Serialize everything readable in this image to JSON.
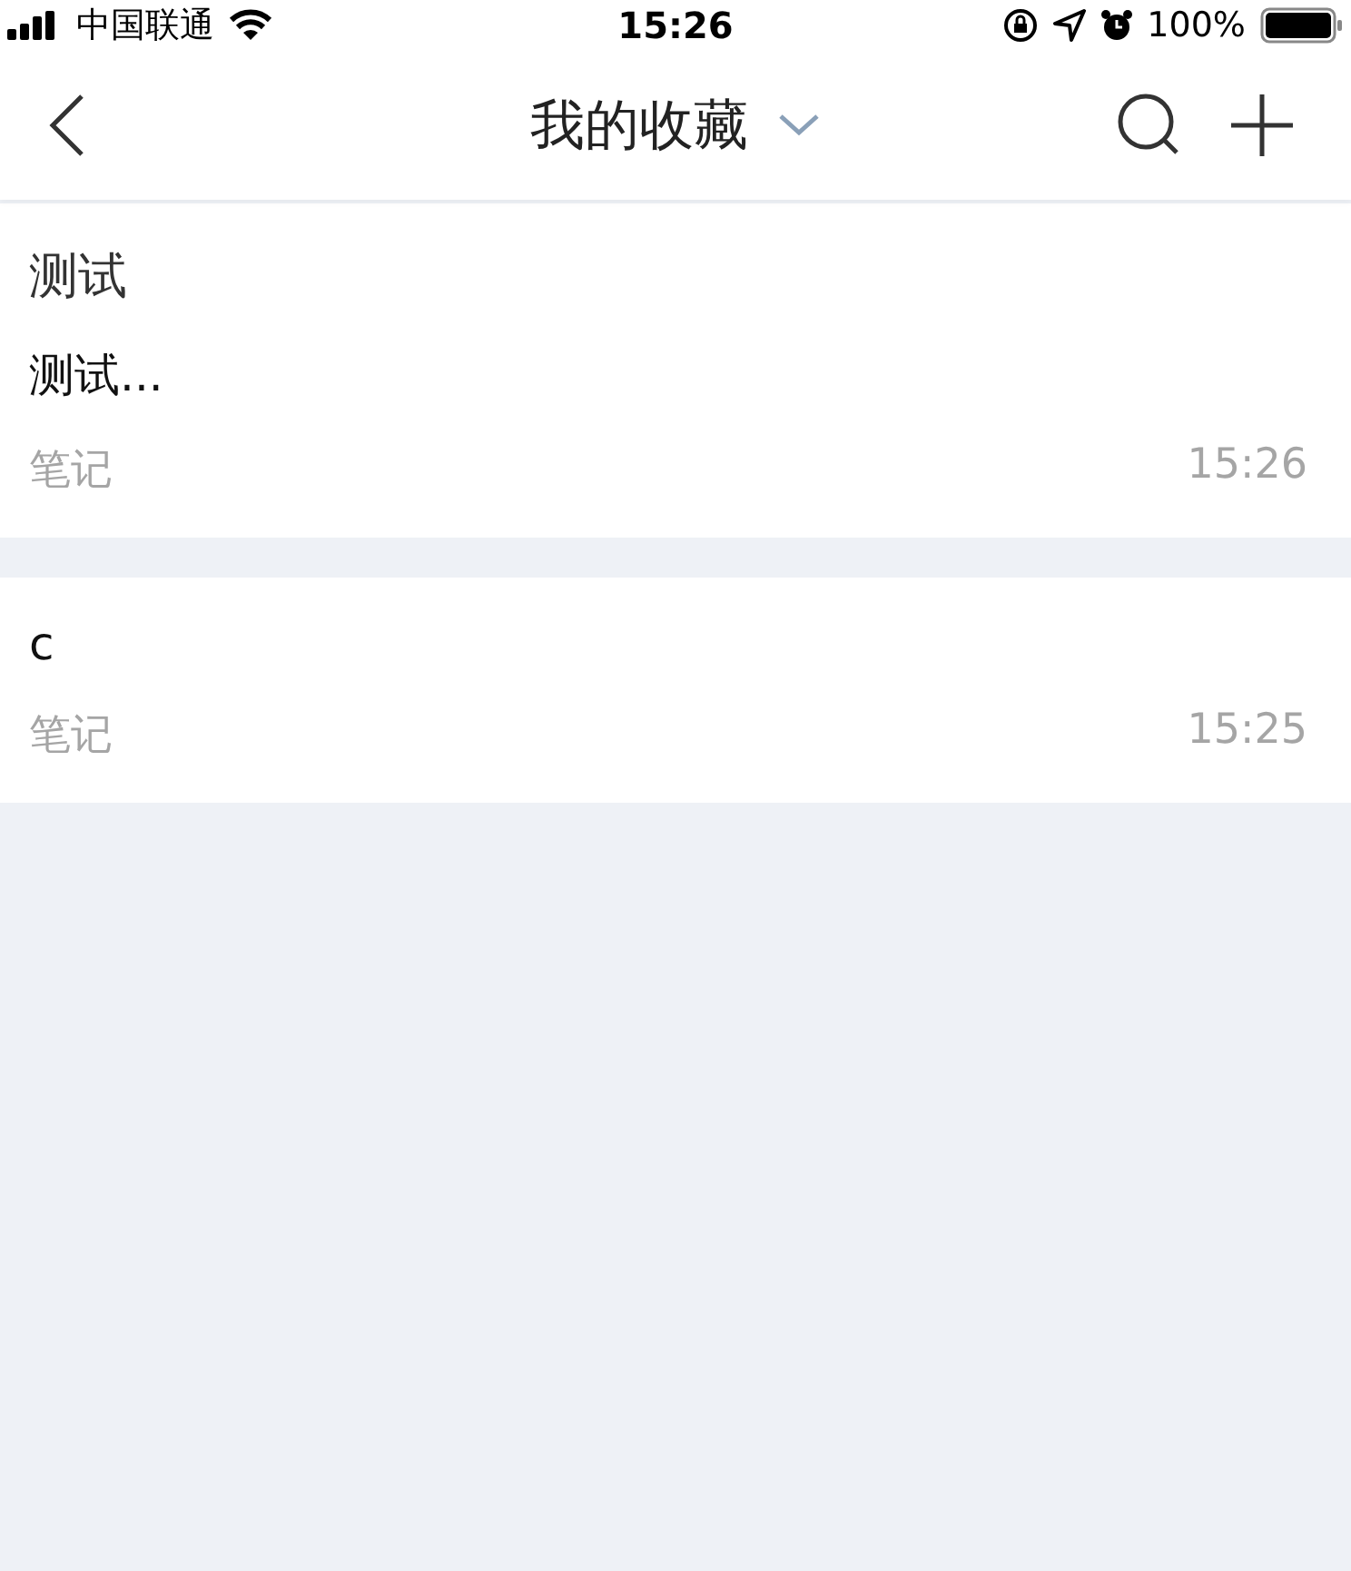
{
  "status_bar": {
    "carrier": "中国联通",
    "time": "15:26",
    "battery": "100%"
  },
  "nav": {
    "title": "我的收藏"
  },
  "items": [
    {
      "title": "测试",
      "body": "测试...",
      "tag": "笔记",
      "time": "15:26"
    },
    {
      "body": "c",
      "tag": "笔记",
      "time": "15:25"
    }
  ]
}
